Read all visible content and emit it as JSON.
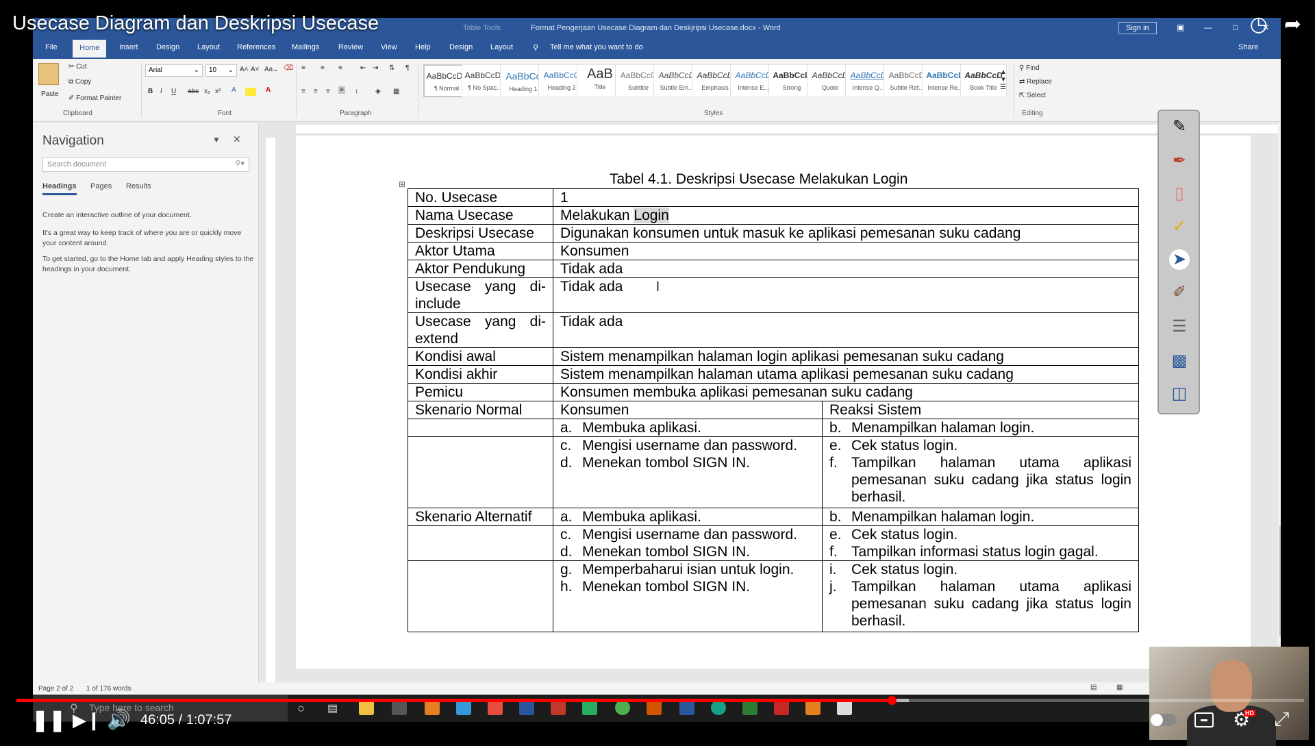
{
  "video": {
    "title": "Usecase Diagram dan Deskripsi Usecase",
    "time": "46:05 / 1:07:57",
    "progress_fraction": 0.68,
    "icons": [
      "clock-icon",
      "share-icon",
      "pause-icon",
      "next-icon",
      "volume-icon",
      "autoplay-toggle-icon",
      "subtitles-icon",
      "settings-icon",
      "exit-fullscreen-icon"
    ],
    "hd_badge": "HD"
  },
  "word": {
    "context_tab": "Table Tools",
    "doc_title": "Format Pengerjaan Usecase Diagram dan Deskjripsi Usecase.docx  -  Word",
    "sign_in": "Sign in",
    "share": "Share",
    "tabs": [
      "File",
      "Home",
      "Insert",
      "Design",
      "Layout",
      "References",
      "Mailings",
      "Review",
      "View",
      "Help",
      "Design",
      "Layout"
    ],
    "tell_me": "Tell me what you want to do",
    "clipboard": {
      "paste": "Paste",
      "cut": "Cut",
      "copy": "Copy",
      "format_painter": "Format Painter",
      "label": "Clipboard"
    },
    "font": {
      "name": "Arial",
      "size": "10",
      "label": "Font"
    },
    "paragraph_label": "Paragraph",
    "styles_label": "Styles",
    "styles": [
      {
        "preview": "AaBbCcDc",
        "name": "¶ Normal"
      },
      {
        "preview": "AaBbCcDc",
        "name": "¶ No Spac..."
      },
      {
        "preview": "AaBbCc",
        "name": "Heading 1"
      },
      {
        "preview": "AaBbCcC",
        "name": "Heading 2"
      },
      {
        "preview": "AaB",
        "name": "Title"
      },
      {
        "preview": "AaBbCcC",
        "name": "Subtitle"
      },
      {
        "preview": "AaBbCcD",
        "name": "Subtle Em..."
      },
      {
        "preview": "AaBbCcD",
        "name": "Emphasis"
      },
      {
        "preview": "AaBbCcD",
        "name": "Intense E..."
      },
      {
        "preview": "AaBbCcD",
        "name": "Strong"
      },
      {
        "preview": "AaBbCcD",
        "name": "Quote"
      },
      {
        "preview": "AaBbCcD",
        "name": "Intense Q..."
      },
      {
        "preview": "AaBbCcD",
        "name": "Subtle Ref..."
      },
      {
        "preview": "AaBbCcD",
        "name": "Intense Re..."
      },
      {
        "preview": "AaBbCcD",
        "name": "Book Title"
      }
    ],
    "editing": {
      "find": "Find",
      "replace": "Replace",
      "select": "Select",
      "label": "Editing"
    },
    "status": {
      "page": "Page 2 of 2",
      "words": "1 of 176 words"
    }
  },
  "navigation": {
    "title": "Navigation",
    "search_placeholder": "Search document",
    "tabs": [
      "Headings",
      "Pages",
      "Results"
    ],
    "p1": "Create an interactive outline of your document.",
    "p2": "It's a great way to keep track of where you are or quickly move your content around.",
    "p3": "To get started, go to the Home tab and apply Heading styles to the headings in your document."
  },
  "document": {
    "caption": "Tabel 4.1. Deskripsi Usecase Melakukan Login",
    "rows": [
      {
        "label": "No. Usecase",
        "value": "1"
      },
      {
        "label": "Nama Usecase",
        "value_prefix": "Melakukan ",
        "value_highlight": "Login"
      },
      {
        "label": "Deskripsi Usecase",
        "value": "Digunakan konsumen untuk masuk ke aplikasi pemesanan suku cadang"
      },
      {
        "label": "Aktor Utama",
        "value": "Konsumen"
      },
      {
        "label": "Aktor Pendukung",
        "value": "Tidak ada"
      },
      {
        "label": "Usecase yang di-include",
        "value": "Tidak ada"
      },
      {
        "label": "Usecase yang di-extend",
        "value": "Tidak ada"
      },
      {
        "label": "Kondisi awal",
        "value": "Sistem menampilkan halaman login aplikasi pemesanan suku cadang"
      },
      {
        "label": "Kondisi akhir",
        "value": "Sistem menampilkan halaman utama aplikasi pemesanan suku cadang"
      },
      {
        "label": "Pemicu",
        "value": "Konsumen membuka aplikasi pemesanan suku cadang"
      }
    ],
    "normal": {
      "label": "Skenario Normal",
      "col_a": "Konsumen",
      "col_b": "Reaksi Sistem",
      "a": "Membuka aplikasi.",
      "b": "Menampilkan halaman login.",
      "c": "Mengisi username dan password.",
      "d": "Menekan tombol SIGN IN.",
      "e": "Cek status login.",
      "f": "Tampilkan halaman utama aplikasi pemesanan suku cadang jika status login berhasil."
    },
    "alternatif": {
      "label": "Skenario Alternatif",
      "a": "Membuka aplikasi.",
      "b": "Menampilkan halaman login.",
      "c": "Mengisi username dan password.",
      "d": "Menekan tombol SIGN IN.",
      "e": "Cek status login.",
      "f": "Tampilkan informasi status login gagal.",
      "g": "Memperbaharui isian untuk login.",
      "h": "Menekan tombol SIGN IN.",
      "i": "Cek status login.",
      "j": "Tampilkan halaman utama aplikasi pemesanan suku cadang jika status login berhasil."
    },
    "markers": {
      "a": "a.",
      "b": "b.",
      "c": "c.",
      "d": "d.",
      "e": "e.",
      "f": "f.",
      "g": "g.",
      "h": "h.",
      "i": "i.",
      "j": "j."
    }
  },
  "taskbar": {
    "search_placeholder": "Type here to search"
  }
}
